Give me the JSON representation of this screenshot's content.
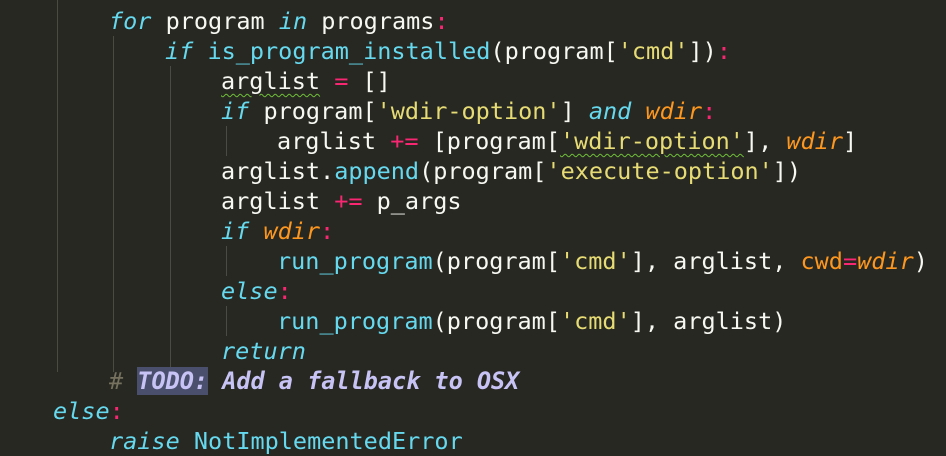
{
  "code": {
    "top_partial": "",
    "line_for": {
      "kw_for": "for",
      "var": " program ",
      "kw_in": "in",
      "rest": " programs",
      "colon": ":"
    },
    "line_if_installed": {
      "kw_if": "if",
      "fn": " is_program_installed",
      "open": "(program[",
      "str_cmd": "'cmd'",
      "close": "])",
      "colon": ":"
    },
    "line_arglist_init": {
      "name": "arglist",
      "op": " = ",
      "value": "[]"
    },
    "line_if_wdir_option": {
      "kw_if": "if",
      "mid": " program[",
      "str": "'wdir-option'",
      "close": "] ",
      "kw_and": "and",
      "param": " wdir",
      "colon": ":"
    },
    "line_arglist_plus": {
      "name": "arglist",
      "op": " += ",
      "open": "[program[",
      "str": "'wdir-option'",
      "close": "], ",
      "param": "wdir",
      "end": "]"
    },
    "line_append": {
      "obj": "arglist.",
      "fn": "append",
      "open": "(program[",
      "str": "'execute-option'",
      "close": "])"
    },
    "line_pargs": {
      "name": "arglist",
      "op": " += ",
      "value": "p_args"
    },
    "line_if_wdir": {
      "kw_if": "if",
      "param": " wdir",
      "colon": ":"
    },
    "line_run_cwd": {
      "fn": "run_program",
      "open": "(program[",
      "str": "'cmd'",
      "mid": "], arglist, ",
      "kwarg": "cwd",
      "eq": "=",
      "param": "wdir",
      "end": ")"
    },
    "line_else_inner": {
      "kw": "else",
      "colon": ":"
    },
    "line_run": {
      "fn": "run_program",
      "open": "(program[",
      "str": "'cmd'",
      "end": "], arglist)"
    },
    "line_return": {
      "kw": "return"
    },
    "line_todo": {
      "hash": "# ",
      "tag": "TODO:",
      "text": " Add a fallback to OSX"
    },
    "line_else_outer": {
      "kw": "else",
      "colon": ":"
    },
    "line_raise": {
      "kw": "raise",
      "rest": " NotImplementedError"
    }
  },
  "colors": {
    "background": "#272822",
    "keyword": "#66d9ef",
    "string": "#e6db74",
    "operator": "#f92672",
    "parameter": "#fd971f",
    "comment": "#75715e",
    "todo_highlight": "#4b4f6e"
  }
}
